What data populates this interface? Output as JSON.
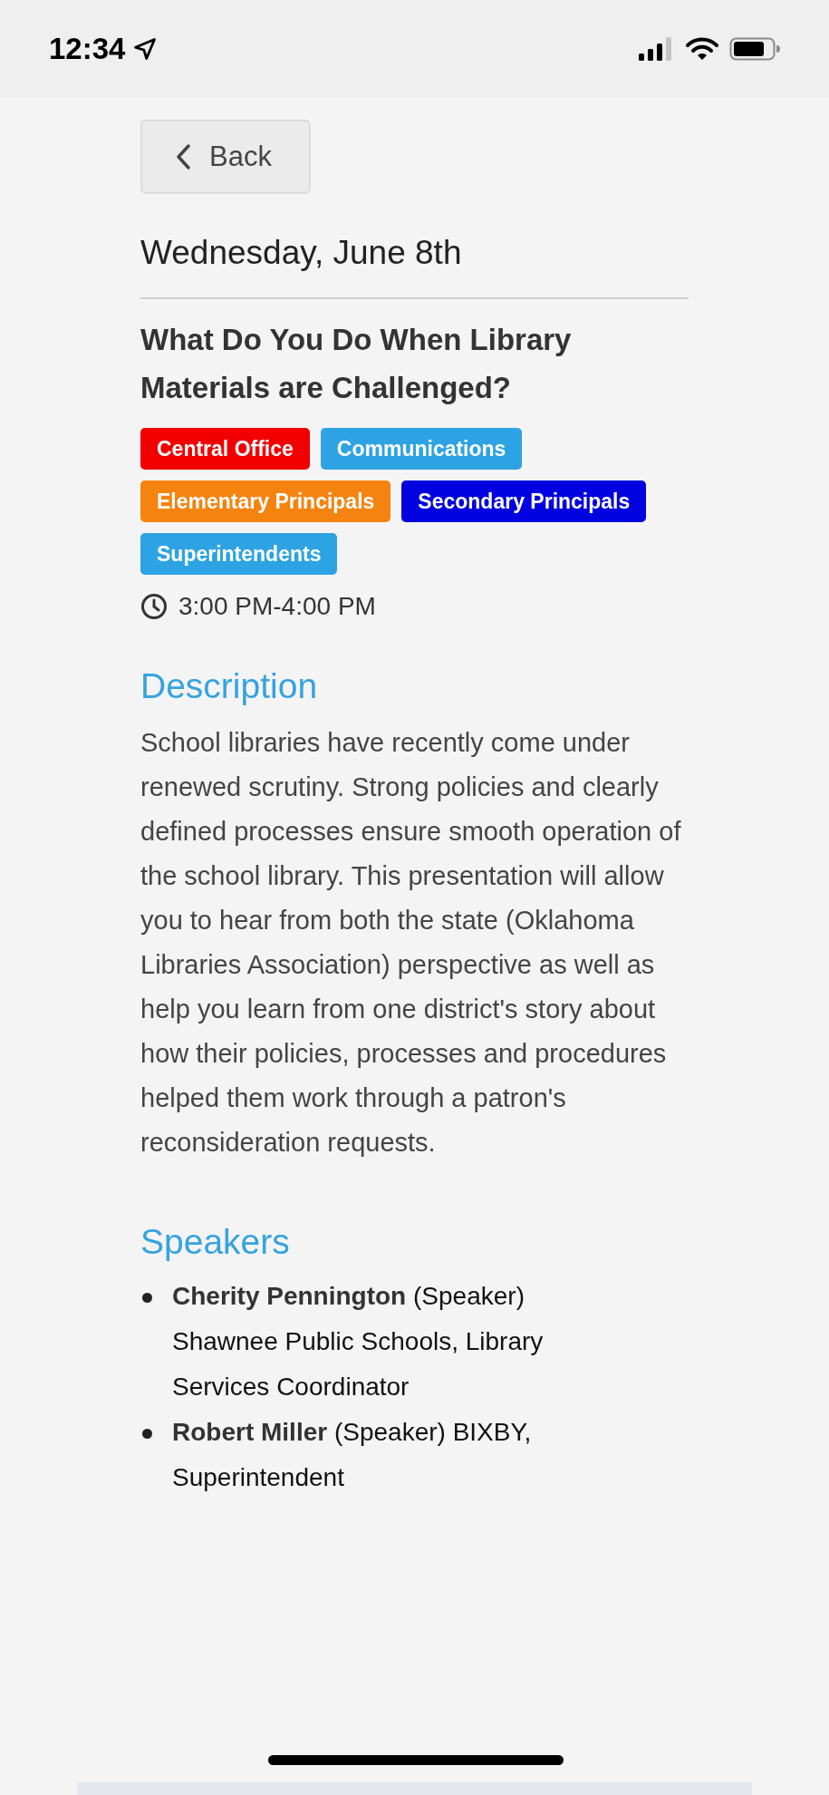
{
  "status_bar": {
    "time": "12:34"
  },
  "back_button": {
    "label": "Back"
  },
  "date": "Wednesday, June 8th",
  "session": {
    "title": "What Do You Do When Library Materials are Challenged?",
    "tags": [
      {
        "label": "Central Office",
        "color": "#f20000"
      },
      {
        "label": "Communications",
        "color": "#2ea3e3"
      },
      {
        "label": "Elementary Principals",
        "color": "#f5830f"
      },
      {
        "label": "Secondary Principals",
        "color": "#0202e0"
      },
      {
        "label": "Superintendents",
        "color": "#2ea3e3"
      }
    ],
    "time": "3:00 PM-4:00 PM"
  },
  "description": {
    "heading": "Description",
    "text": "School libraries have recently come under renewed scrutiny. Strong policies and clearly defined processes ensure smooth operation of the school library. This presentation will allow you to hear from both the state (Oklahoma Libraries Association) perspective as well as help you learn from one district's story about how their policies, processes and procedures helped them work through a patron's reconsideration requests."
  },
  "speakers": {
    "heading": "Speakers",
    "items": [
      {
        "name": "Cherity Pennington",
        "details": "(Speaker) Shawnee Public Schools, Library Services Coordinator"
      },
      {
        "name": "Robert Miller",
        "details": "(Speaker) BIXBY, Superintendent"
      }
    ]
  }
}
